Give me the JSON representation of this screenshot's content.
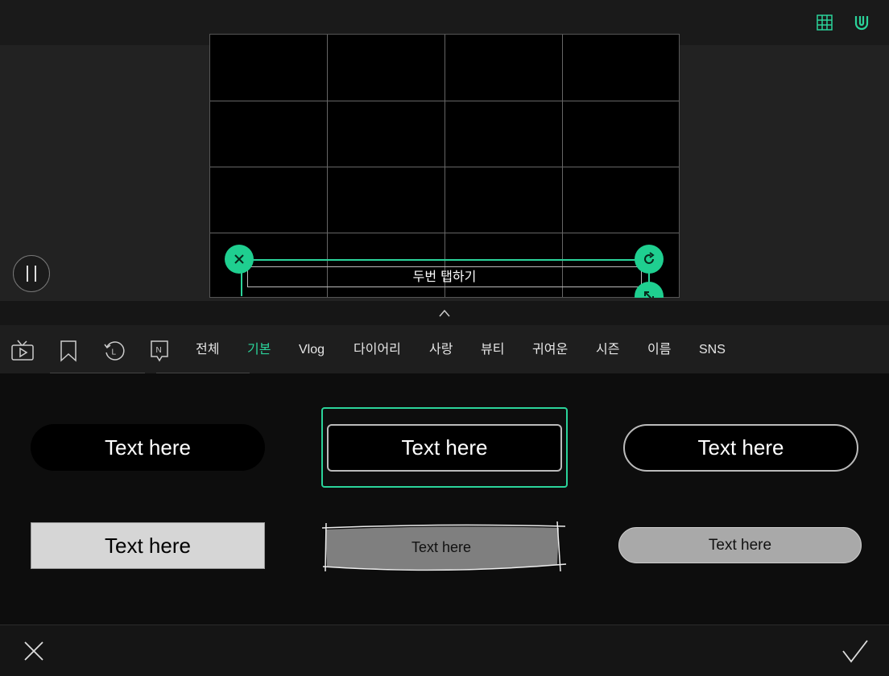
{
  "canvas_overlay": {
    "text": "두번 탭하기"
  },
  "tabs": {
    "icons": [
      "tv-play-icon",
      "bookmark-icon",
      "recent-history-icon",
      "new-badge-icon"
    ],
    "items": [
      {
        "label": "전체",
        "active": false
      },
      {
        "label": "기본",
        "active": true
      },
      {
        "label": "Vlog",
        "active": false
      },
      {
        "label": "다이어리",
        "active": false
      },
      {
        "label": "사랑",
        "active": false
      },
      {
        "label": "뷰티",
        "active": false
      },
      {
        "label": "귀여운",
        "active": false
      },
      {
        "label": "시즌",
        "active": false
      },
      {
        "label": "이름",
        "active": false
      },
      {
        "label": "SNS",
        "active": false
      }
    ]
  },
  "presets": [
    {
      "label": "Text here",
      "style": "black-pill"
    },
    {
      "label": "Text here",
      "style": "outlined-rect",
      "selected": true
    },
    {
      "label": "Text here",
      "style": "outlined-pill"
    },
    {
      "label": "Text here",
      "style": "light-gray-rect"
    },
    {
      "label": "Text here",
      "style": "sketch-gray"
    },
    {
      "label": "Text here",
      "style": "gray-pill"
    }
  ],
  "colors": {
    "accent": "#2bd39a",
    "handle": "#1fcf90"
  }
}
